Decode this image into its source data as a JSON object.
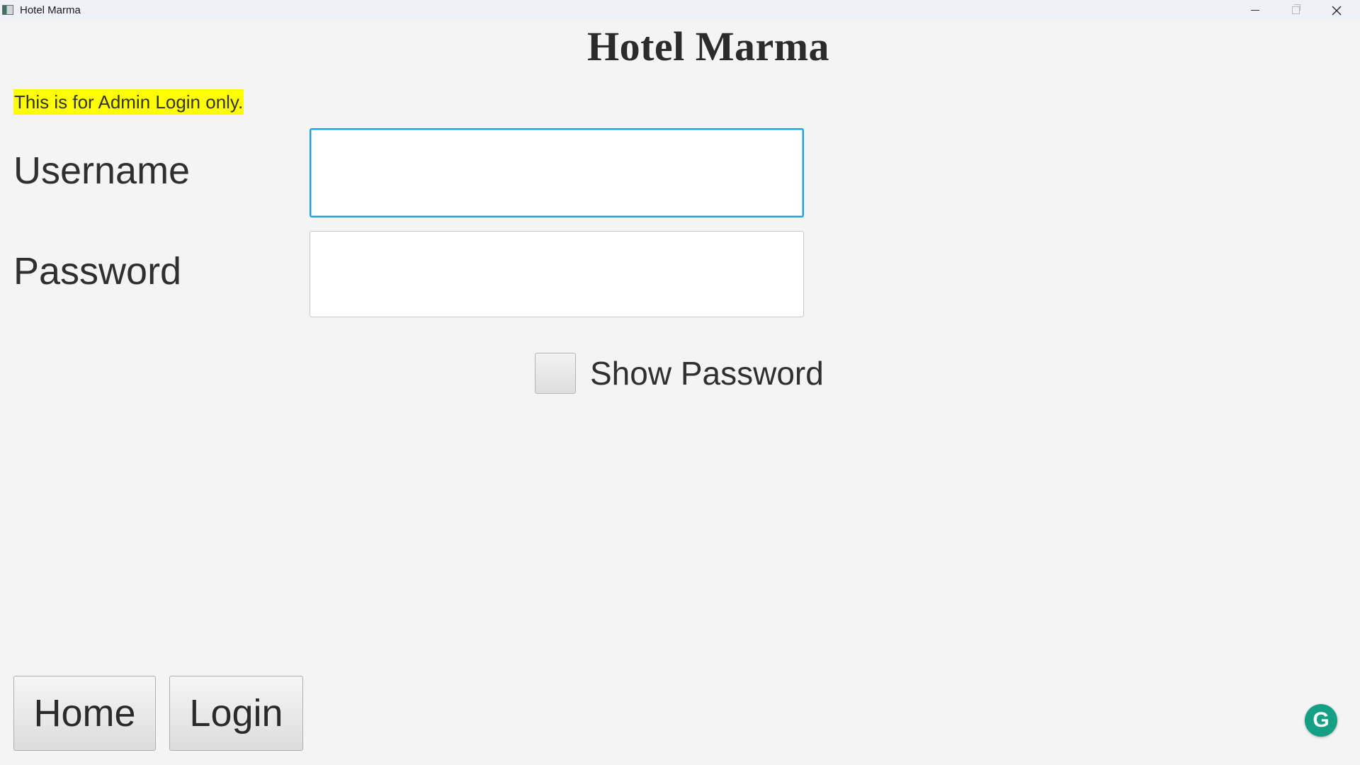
{
  "window": {
    "title": "Hotel Marma",
    "controls": {
      "minimize_icon": "minimize-icon",
      "maximize_icon": "restore-icon",
      "close_icon": "close-icon"
    }
  },
  "header": {
    "title": "Hotel Marma"
  },
  "notice": {
    "text": "This is for Admin Login only.",
    "highlight_color": "#ffff00"
  },
  "form": {
    "username_label": "Username",
    "username_value": "",
    "password_label": "Password",
    "password_value": "",
    "show_password_label": "Show Password",
    "show_password_checked": false,
    "focus_color": "#1fa0dc"
  },
  "buttons": {
    "home_label": "Home",
    "login_label": "Login"
  },
  "overlay": {
    "grammarly_icon": "grammarly-icon",
    "grammarly_letter": "G",
    "grammarly_color": "#15a085"
  }
}
